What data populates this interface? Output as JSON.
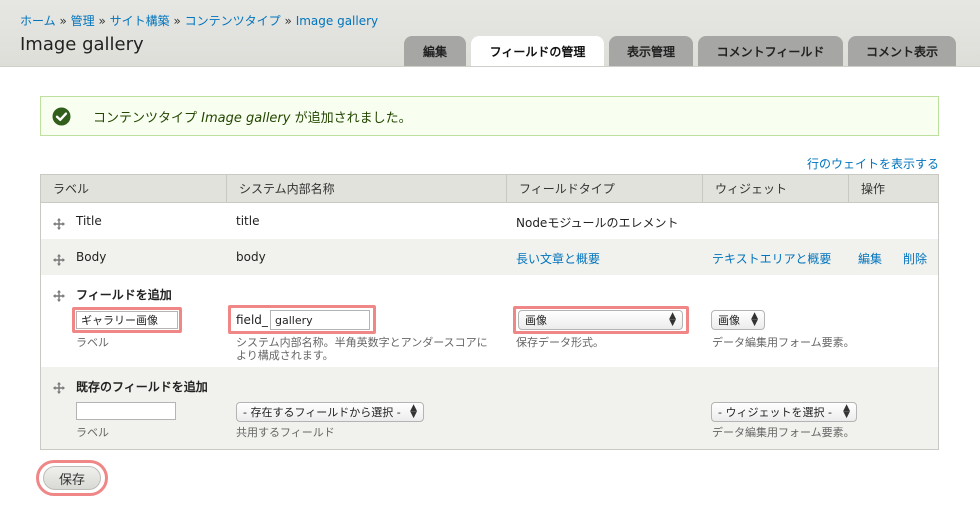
{
  "breadcrumb": {
    "items": [
      "ホーム",
      "管理",
      "サイト構築",
      "コンテンツタイプ",
      "Image gallery"
    ],
    "separator": "»"
  },
  "page_title": "Image gallery",
  "tabs": [
    {
      "label": "編集",
      "active": false
    },
    {
      "label": "フィールドの管理",
      "active": true
    },
    {
      "label": "表示管理",
      "active": false
    },
    {
      "label": "コメントフィールド",
      "active": false
    },
    {
      "label": "コメント表示",
      "active": false
    }
  ],
  "message": {
    "prefix": "コンテンツタイプ ",
    "name": "Image gallery",
    "suffix": " が追加されました。",
    "icon": "check-circle-icon",
    "color": "#234600"
  },
  "row_weights_link": "行のウェイトを表示する",
  "table": {
    "headers": [
      "ラベル",
      "システム内部名称",
      "フィールドタイプ",
      "ウィジェット",
      "操作"
    ],
    "rows": [
      {
        "label": "Title",
        "machine": "title",
        "type": "Nodeモジュールのエレメント",
        "widget": "",
        "edit": "",
        "delete": ""
      },
      {
        "label": "Body",
        "machine": "body",
        "type": "長い文章と概要",
        "widget": "テキストエリアと概要",
        "edit": "編集",
        "delete": "削除"
      }
    ],
    "add_new": {
      "title": "フィールドを追加",
      "label_value": "ギャラリー画像",
      "label_desc": "ラベル",
      "field_prefix": "field_",
      "machine_value": "gallery",
      "machine_desc": "システム内部名称。半角英数字とアンダースコアにより構成されます。",
      "type_value": "画像",
      "type_desc": "保存データ形式。",
      "widget_value": "画像",
      "widget_desc": "データ編集用フォーム要素。"
    },
    "add_existing": {
      "title": "既存のフィールドを追加",
      "label_value": "",
      "label_desc": "ラベル",
      "field_select": "- 存在するフィールドから選択 -",
      "field_desc": "共用するフィールド",
      "widget_select": "- ウィジェットを選択 -",
      "widget_desc": "データ編集用フォーム要素。"
    }
  },
  "save_label": "保存",
  "colors": {
    "link": "#0074bd",
    "highlight": "#ef8787",
    "success_bg": "#f8fff0"
  }
}
